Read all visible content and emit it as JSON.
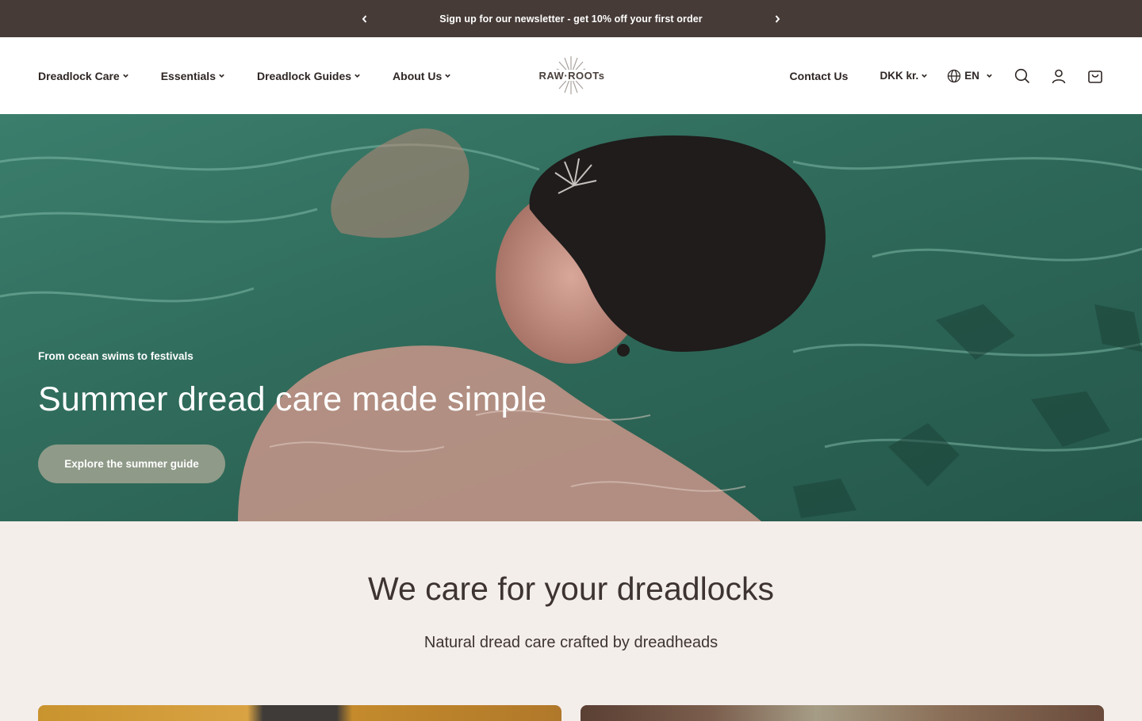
{
  "announcement": {
    "message": "Sign up for our newsletter - get 10% off your first order",
    "prev_icon": "chevron-left-icon",
    "next_icon": "chevron-right-icon"
  },
  "header": {
    "logo_text": "RAW·ROOTs",
    "nav_left": [
      {
        "label": "Dreadlock Care"
      },
      {
        "label": "Essentials"
      },
      {
        "label": "Dreadlock Guides"
      },
      {
        "label": "About Us"
      }
    ],
    "contact_label": "Contact Us",
    "currency_label": "DKK kr.",
    "language_label": "EN",
    "icons": [
      "globe-icon",
      "search-icon",
      "account-icon",
      "cart-icon"
    ]
  },
  "hero": {
    "kicker": "From ocean swims to festivals",
    "headline": "Summer dread care made simple",
    "cta_label": "Explore the summer guide"
  },
  "intro": {
    "title": "We care for your dreadlocks",
    "subtitle": "Natural dread care crafted by dreadheads"
  },
  "colors": {
    "announcement_bg": "#463b37",
    "header_bg": "#ffffff",
    "page_bg": "#f4eeeb",
    "cta_bg": "#8f9a88",
    "text_dark": "#3d3431"
  }
}
